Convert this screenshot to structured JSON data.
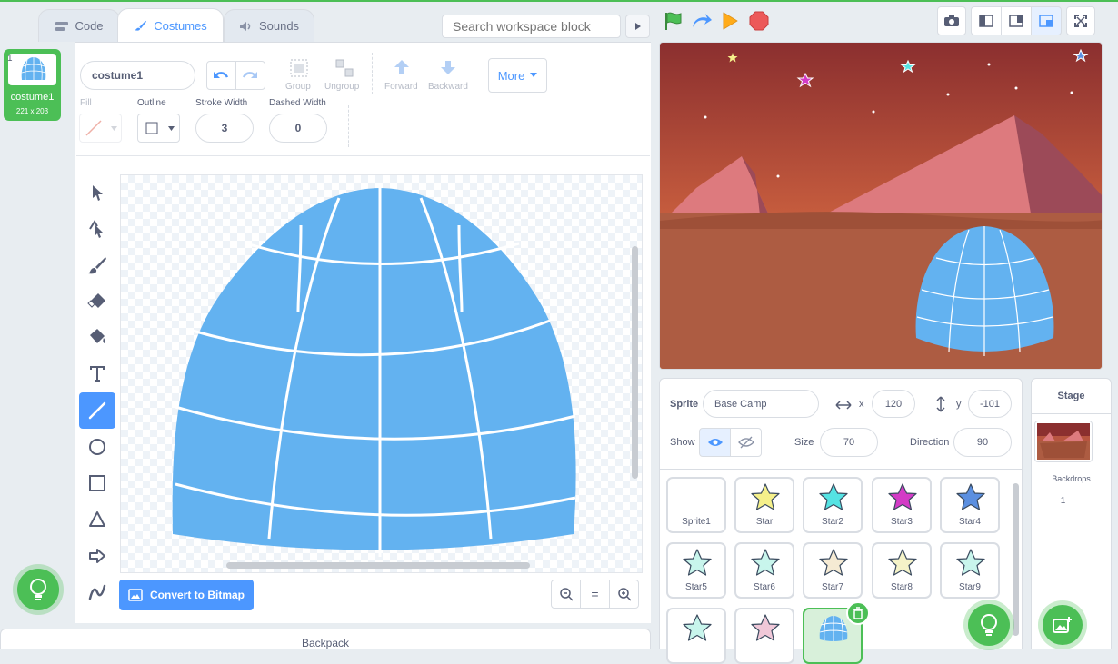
{
  "tabs": {
    "code": "Code",
    "costumes": "Costumes",
    "sounds": "Sounds"
  },
  "search": {
    "placeholder": "Search workspace block"
  },
  "costume_list": {
    "items": [
      {
        "number": "1",
        "name": "costume1",
        "size": "221 x 203"
      }
    ]
  },
  "paint": {
    "costume_name": "costume1",
    "group": "Group",
    "ungroup": "Ungroup",
    "forward": "Forward",
    "backward": "Backward",
    "more": "More",
    "fill": "Fill",
    "outline": "Outline",
    "stroke_width_label": "Stroke Width",
    "stroke_width": "3",
    "dashed_width_label": "Dashed Width",
    "dashed_width": "0",
    "convert": "Convert to Bitmap",
    "zoom_reset": "="
  },
  "backpack": "Backpack",
  "sprite_info": {
    "sprite_label": "Sprite",
    "sprite_name": "Base Camp",
    "x_label": "x",
    "x": "120",
    "y_label": "y",
    "y": "-101",
    "show_label": "Show",
    "size_label": "Size",
    "size": "70",
    "direction_label": "Direction",
    "direction": "90"
  },
  "sprites": [
    {
      "name": "Sprite1",
      "icon": "none",
      "color": "#ffffff"
    },
    {
      "name": "Star",
      "icon": "star-icon",
      "color": "#f5f08a"
    },
    {
      "name": "Star2",
      "icon": "star-icon",
      "color": "#55e3e3"
    },
    {
      "name": "Star3",
      "icon": "star-icon",
      "color": "#d33bc6"
    },
    {
      "name": "Star4",
      "icon": "star-icon",
      "color": "#5b8fe0"
    },
    {
      "name": "Star5",
      "icon": "star-icon",
      "color": "#c8f5ec"
    },
    {
      "name": "Star6",
      "icon": "star-icon",
      "color": "#c8f5ec"
    },
    {
      "name": "Star7",
      "icon": "star-icon",
      "color": "#f5ead3"
    },
    {
      "name": "Star8",
      "icon": "star-icon",
      "color": "#f5f3c8"
    },
    {
      "name": "Star9",
      "icon": "star-icon",
      "color": "#c8f5ec"
    },
    {
      "name": "",
      "icon": "star-icon",
      "color": "#c8f5ec"
    },
    {
      "name": "",
      "icon": "star-icon",
      "color": "#f0c8d8"
    },
    {
      "name": "",
      "icon": "igloo-icon",
      "color": "#63b2f0"
    }
  ],
  "stage_panel": {
    "title": "Stage",
    "backdrops_label": "Backdrops",
    "backdrops_count": "1"
  },
  "colors": {
    "accent": "#4c97ff",
    "green": "#4cbf56",
    "igloo": "#63b2f0",
    "sky_top": "#8b2f2f",
    "sky_bottom": "#d97a45",
    "ground": "#ad5c42",
    "mountain": "#dd7a7e"
  }
}
